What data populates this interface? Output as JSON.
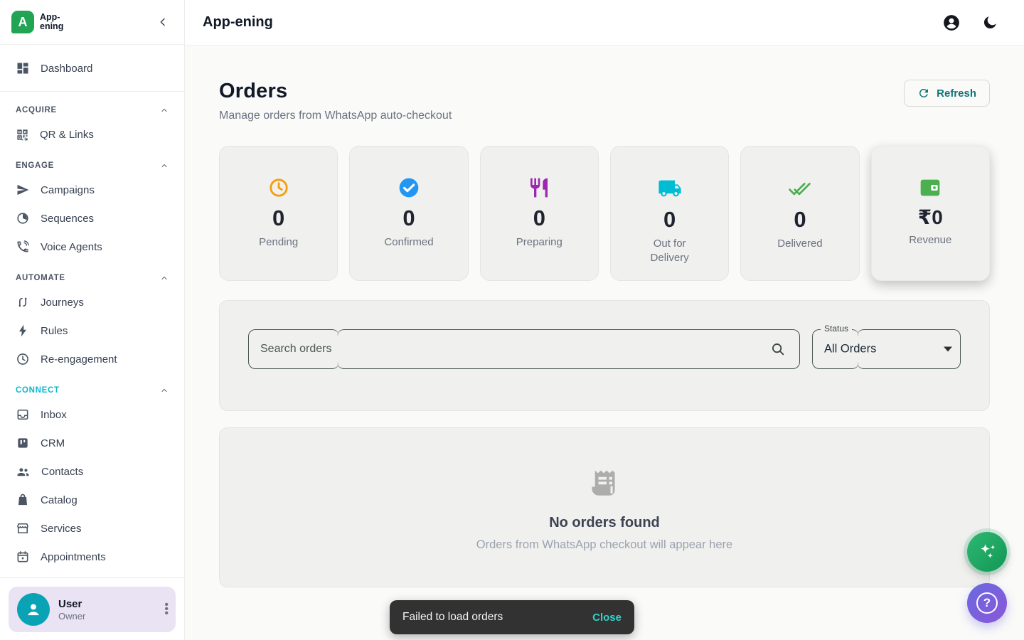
{
  "app": {
    "logo_line1": "App-",
    "logo_line2": "ening",
    "logo_letter": "A"
  },
  "header": {
    "title": "App-ening"
  },
  "sidebar": {
    "dashboard_label": "Dashboard",
    "sections": [
      {
        "label": "ACQUIRE",
        "items": [
          {
            "label": "QR & Links",
            "icon": "qr-code-icon"
          }
        ]
      },
      {
        "label": "ENGAGE",
        "items": [
          {
            "label": "Campaigns",
            "icon": "send-icon"
          },
          {
            "label": "Sequences",
            "icon": "progress-circle-icon"
          },
          {
            "label": "Voice Agents",
            "icon": "phone-icon"
          }
        ]
      },
      {
        "label": "AUTOMATE",
        "items": [
          {
            "label": "Journeys",
            "icon": "route-icon"
          },
          {
            "label": "Rules",
            "icon": "bolt-icon"
          },
          {
            "label": "Re-engagement",
            "icon": "clock-icon"
          }
        ]
      },
      {
        "label": "CONNECT",
        "accent_color": "#0bb7cd",
        "items": [
          {
            "label": "Inbox",
            "icon": "inbox-icon"
          },
          {
            "label": "CRM",
            "icon": "kanban-icon"
          },
          {
            "label": "Contacts",
            "icon": "people-icon"
          },
          {
            "label": "Catalog",
            "icon": "shopping-bag-icon"
          },
          {
            "label": "Services",
            "icon": "storefront-icon"
          },
          {
            "label": "Appointments",
            "icon": "calendar-icon"
          }
        ]
      }
    ],
    "user": {
      "name": "User",
      "role": "Owner"
    }
  },
  "page": {
    "title": "Orders",
    "subtitle": "Manage orders from WhatsApp auto-checkout",
    "refresh_label": "Refresh"
  },
  "stats": {
    "cards": [
      {
        "label": "Pending",
        "value": "0",
        "icon": "clock-icon",
        "color": "#f59e0b"
      },
      {
        "label": "Confirmed",
        "value": "0",
        "icon": "check-circle-icon",
        "color": "#2196f3"
      },
      {
        "label": "Preparing",
        "value": "0",
        "icon": "restaurant-icon",
        "color": "#9c27b0"
      },
      {
        "label": "Out for Delivery",
        "value": "0",
        "icon": "truck-icon",
        "color": "#00bcd4"
      },
      {
        "label": "Delivered",
        "value": "0",
        "icon": "done-all-icon",
        "color": "#4caf50"
      },
      {
        "label": "Revenue",
        "value": "₹0",
        "icon": "wallet-icon",
        "color": "#4caf50"
      }
    ]
  },
  "filters": {
    "search_placeholder": "Search orders",
    "search_value": "",
    "status_label": "Status",
    "status_value": "All Orders"
  },
  "empty_state": {
    "title": "No orders found",
    "subtitle": "Orders from WhatsApp checkout will appear here"
  },
  "toast": {
    "message": "Failed to load orders",
    "action": "Close"
  },
  "colors": {
    "accent_teal": "#0e7674",
    "toast_action": "#2ed3cb",
    "avatar": "#0aa3b5",
    "logo_green": "#22a455"
  }
}
